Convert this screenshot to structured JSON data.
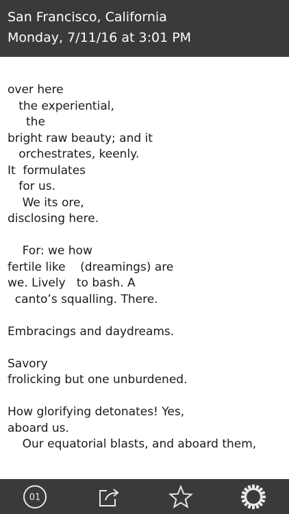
{
  "header": {
    "location": "San Francisco, California",
    "datetime": "Monday, 7/11/16 at 3:01 PM"
  },
  "poem": {
    "text": "over here\n   the experiential,\n     the\nbright raw beauty; and it\n   orchestrates, keenly.\nIt  formulates\n   for us.\n    We its ore,\ndisclosing here.\n\n    For: we how\nfertile like    (dreamings) are\nwe. Lively   to bash. A\n  canto’s squalling. There.\n\nEmbracings and daydreams.\n\nSavory\nfrolicking but one unburdened.\n\nHow glorifying detonates! Yes,\naboard us.\n    Our equatorial blasts, and aboard them,"
  },
  "toolbar": {
    "counter_label": "01",
    "icons": [
      "counter-icon",
      "share-icon",
      "star-icon",
      "gear-icon"
    ]
  },
  "colors": {
    "bar_background": "#3a3a3a",
    "bar_foreground": "#ffffff",
    "page_background": "#ffffff",
    "text": "#1a1a1a"
  }
}
